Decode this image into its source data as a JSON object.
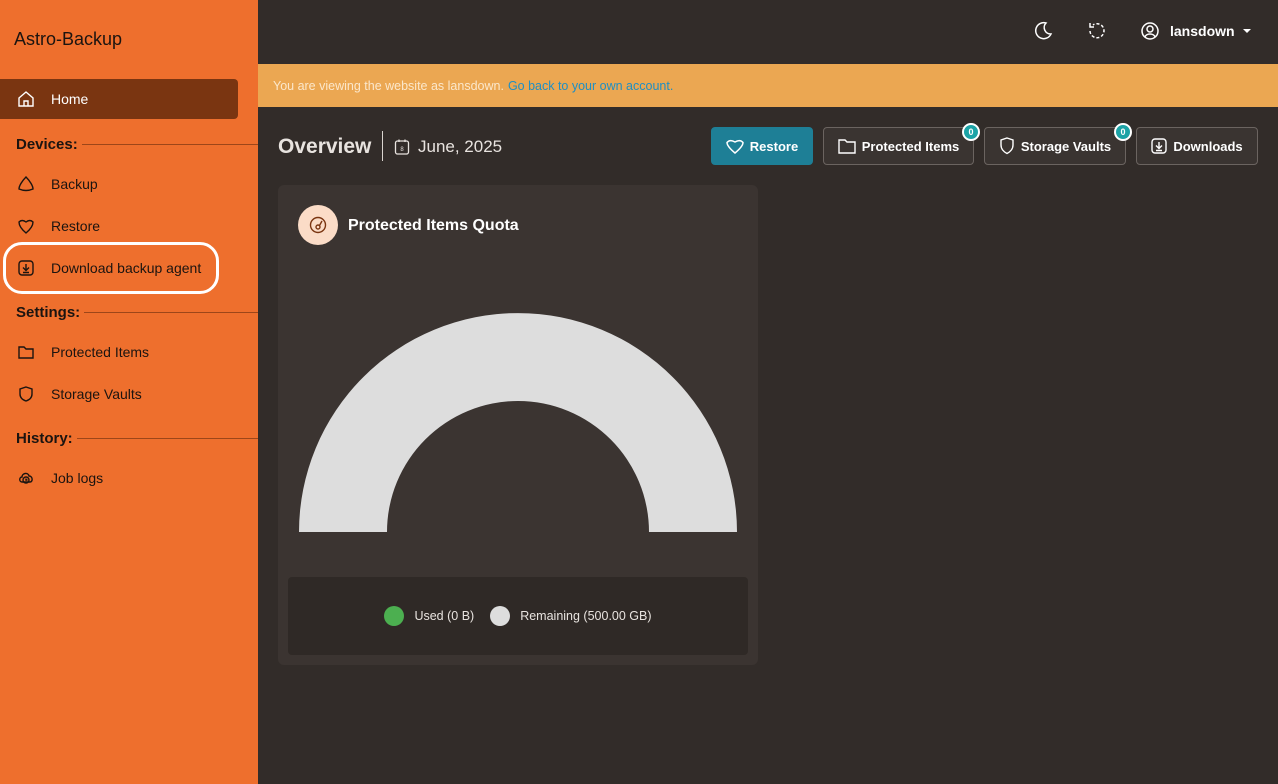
{
  "app": {
    "title": "Astro-Backup"
  },
  "sidebar": {
    "home": "Home",
    "devices_label": "Devices:",
    "devices": [
      "Backup",
      "Restore",
      "Download backup agent"
    ],
    "settings_label": "Settings:",
    "settings": [
      "Protected Items",
      "Storage Vaults"
    ],
    "history_label": "History:",
    "history": [
      "Job logs"
    ]
  },
  "topbar": {
    "username": "lansdown"
  },
  "banner": {
    "text": "You are viewing the website as lansdown.",
    "link": "Go back to your own account."
  },
  "header": {
    "title": "Overview",
    "date": "June, 2025",
    "buttons": {
      "restore": "Restore",
      "protected_items": "Protected Items",
      "protected_items_count": "0",
      "storage_vaults": "Storage Vaults",
      "storage_vaults_count": "0",
      "downloads": "Downloads"
    }
  },
  "card": {
    "title": "Protected Items Quota",
    "legend": {
      "used": "Used (0 B)",
      "remaining": "Remaining (500.00 GB)"
    }
  },
  "colors": {
    "accent": "#ee6f2d",
    "used": "#4caf50",
    "remaining": "#dddddd",
    "primary_button": "#1e7f96"
  },
  "chart_data": {
    "type": "pie",
    "style": "half-donut",
    "categories": [
      "Used (0 B)",
      "Remaining (500.00 GB)"
    ],
    "values": [
      0,
      500
    ],
    "unit": "GB",
    "title": "Protected Items Quota"
  }
}
